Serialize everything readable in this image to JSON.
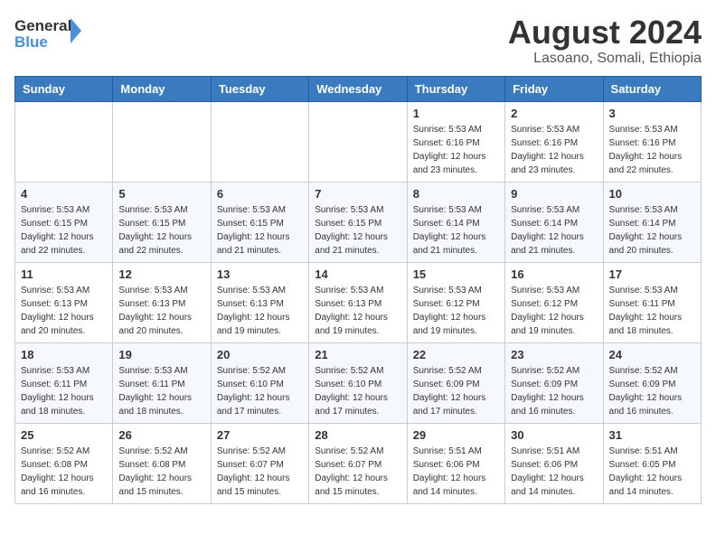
{
  "header": {
    "logo_line1": "General",
    "logo_line2": "Blue",
    "month_year": "August 2024",
    "location": "Lasoano, Somali, Ethiopia"
  },
  "weekdays": [
    "Sunday",
    "Monday",
    "Tuesday",
    "Wednesday",
    "Thursday",
    "Friday",
    "Saturday"
  ],
  "weeks": [
    [
      {
        "day": "",
        "info": ""
      },
      {
        "day": "",
        "info": ""
      },
      {
        "day": "",
        "info": ""
      },
      {
        "day": "",
        "info": ""
      },
      {
        "day": "1",
        "info": "Sunrise: 5:53 AM\nSunset: 6:16 PM\nDaylight: 12 hours\nand 23 minutes."
      },
      {
        "day": "2",
        "info": "Sunrise: 5:53 AM\nSunset: 6:16 PM\nDaylight: 12 hours\nand 23 minutes."
      },
      {
        "day": "3",
        "info": "Sunrise: 5:53 AM\nSunset: 6:16 PM\nDaylight: 12 hours\nand 22 minutes."
      }
    ],
    [
      {
        "day": "4",
        "info": "Sunrise: 5:53 AM\nSunset: 6:15 PM\nDaylight: 12 hours\nand 22 minutes."
      },
      {
        "day": "5",
        "info": "Sunrise: 5:53 AM\nSunset: 6:15 PM\nDaylight: 12 hours\nand 22 minutes."
      },
      {
        "day": "6",
        "info": "Sunrise: 5:53 AM\nSunset: 6:15 PM\nDaylight: 12 hours\nand 21 minutes."
      },
      {
        "day": "7",
        "info": "Sunrise: 5:53 AM\nSunset: 6:15 PM\nDaylight: 12 hours\nand 21 minutes."
      },
      {
        "day": "8",
        "info": "Sunrise: 5:53 AM\nSunset: 6:14 PM\nDaylight: 12 hours\nand 21 minutes."
      },
      {
        "day": "9",
        "info": "Sunrise: 5:53 AM\nSunset: 6:14 PM\nDaylight: 12 hours\nand 21 minutes."
      },
      {
        "day": "10",
        "info": "Sunrise: 5:53 AM\nSunset: 6:14 PM\nDaylight: 12 hours\nand 20 minutes."
      }
    ],
    [
      {
        "day": "11",
        "info": "Sunrise: 5:53 AM\nSunset: 6:13 PM\nDaylight: 12 hours\nand 20 minutes."
      },
      {
        "day": "12",
        "info": "Sunrise: 5:53 AM\nSunset: 6:13 PM\nDaylight: 12 hours\nand 20 minutes."
      },
      {
        "day": "13",
        "info": "Sunrise: 5:53 AM\nSunset: 6:13 PM\nDaylight: 12 hours\nand 19 minutes."
      },
      {
        "day": "14",
        "info": "Sunrise: 5:53 AM\nSunset: 6:13 PM\nDaylight: 12 hours\nand 19 minutes."
      },
      {
        "day": "15",
        "info": "Sunrise: 5:53 AM\nSunset: 6:12 PM\nDaylight: 12 hours\nand 19 minutes."
      },
      {
        "day": "16",
        "info": "Sunrise: 5:53 AM\nSunset: 6:12 PM\nDaylight: 12 hours\nand 19 minutes."
      },
      {
        "day": "17",
        "info": "Sunrise: 5:53 AM\nSunset: 6:11 PM\nDaylight: 12 hours\nand 18 minutes."
      }
    ],
    [
      {
        "day": "18",
        "info": "Sunrise: 5:53 AM\nSunset: 6:11 PM\nDaylight: 12 hours\nand 18 minutes."
      },
      {
        "day": "19",
        "info": "Sunrise: 5:53 AM\nSunset: 6:11 PM\nDaylight: 12 hours\nand 18 minutes."
      },
      {
        "day": "20",
        "info": "Sunrise: 5:52 AM\nSunset: 6:10 PM\nDaylight: 12 hours\nand 17 minutes."
      },
      {
        "day": "21",
        "info": "Sunrise: 5:52 AM\nSunset: 6:10 PM\nDaylight: 12 hours\nand 17 minutes."
      },
      {
        "day": "22",
        "info": "Sunrise: 5:52 AM\nSunset: 6:09 PM\nDaylight: 12 hours\nand 17 minutes."
      },
      {
        "day": "23",
        "info": "Sunrise: 5:52 AM\nSunset: 6:09 PM\nDaylight: 12 hours\nand 16 minutes."
      },
      {
        "day": "24",
        "info": "Sunrise: 5:52 AM\nSunset: 6:09 PM\nDaylight: 12 hours\nand 16 minutes."
      }
    ],
    [
      {
        "day": "25",
        "info": "Sunrise: 5:52 AM\nSunset: 6:08 PM\nDaylight: 12 hours\nand 16 minutes."
      },
      {
        "day": "26",
        "info": "Sunrise: 5:52 AM\nSunset: 6:08 PM\nDaylight: 12 hours\nand 15 minutes."
      },
      {
        "day": "27",
        "info": "Sunrise: 5:52 AM\nSunset: 6:07 PM\nDaylight: 12 hours\nand 15 minutes."
      },
      {
        "day": "28",
        "info": "Sunrise: 5:52 AM\nSunset: 6:07 PM\nDaylight: 12 hours\nand 15 minutes."
      },
      {
        "day": "29",
        "info": "Sunrise: 5:51 AM\nSunset: 6:06 PM\nDaylight: 12 hours\nand 14 minutes."
      },
      {
        "day": "30",
        "info": "Sunrise: 5:51 AM\nSunset: 6:06 PM\nDaylight: 12 hours\nand 14 minutes."
      },
      {
        "day": "31",
        "info": "Sunrise: 5:51 AM\nSunset: 6:05 PM\nDaylight: 12 hours\nand 14 minutes."
      }
    ]
  ]
}
